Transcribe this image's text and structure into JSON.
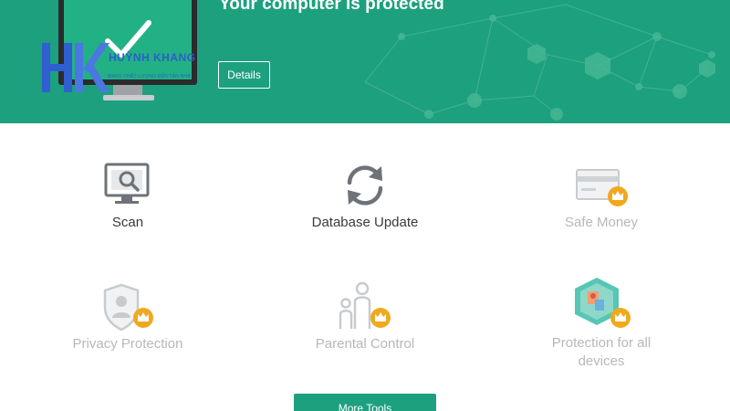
{
  "header": {
    "status_title": "Your computer is protected",
    "details_label": "Details",
    "accent_color": "#1da07e"
  },
  "watermark": {
    "letters": "HK",
    "name": "HUỲNH KHANG",
    "slogan": "MANG CHẤT LƯỢNG ĐẾN TẬN NHÀ"
  },
  "tiles": [
    {
      "label": "Scan",
      "icon": "scan-monitor-icon",
      "premium": false
    },
    {
      "label": "Database Update",
      "icon": "refresh-icon",
      "premium": false
    },
    {
      "label": "Safe Money",
      "icon": "credit-card-icon",
      "premium": true
    },
    {
      "label": "Privacy Protection",
      "icon": "shield-user-icon",
      "premium": true
    },
    {
      "label": "Parental Control",
      "icon": "family-icon",
      "premium": true
    },
    {
      "label": "Protection for all devices",
      "icon": "devices-map-icon",
      "premium": true
    }
  ],
  "more_tools_label": "More Tools"
}
